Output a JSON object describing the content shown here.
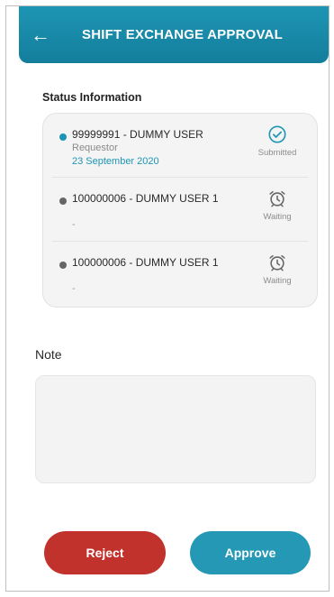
{
  "header": {
    "title": "SHIFT EXCHANGE APPROVAL",
    "back_icon": "arrow-left-icon",
    "color": "#1e95b4"
  },
  "status": {
    "section_title": "Status Information",
    "items": [
      {
        "name": "99999991 - DUMMY USER",
        "role": "Requestor",
        "date": "23 September 2020",
        "state_label": "Submitted",
        "icon": "check-circle-icon",
        "dot_color": "#1e95b4"
      },
      {
        "name": "100000006 - DUMMY USER 1",
        "detail": "-",
        "state_label": "Waiting",
        "icon": "alarm-clock-icon",
        "dot_color": "#666666"
      },
      {
        "name": "100000006 - DUMMY USER 1",
        "detail": "-",
        "state_label": "Waiting",
        "icon": "alarm-clock-icon",
        "dot_color": "#666666"
      }
    ]
  },
  "note": {
    "label": "Note",
    "value": ""
  },
  "actions": {
    "reject_label": "Reject",
    "approve_label": "Approve",
    "reject_color": "#c0322b",
    "approve_color": "#2598b5"
  }
}
